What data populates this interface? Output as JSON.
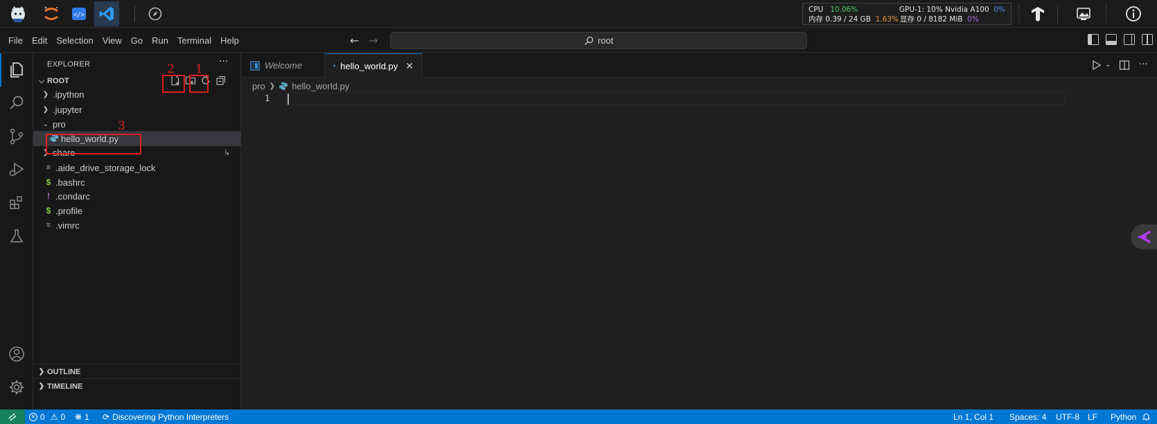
{
  "topbar": {
    "apps": [
      {
        "name": "jupyter-cat-logo"
      },
      {
        "name": "jupyter-logo"
      },
      {
        "name": "code-viewer-app"
      },
      {
        "name": "vscode-app"
      },
      {
        "name": "compass-icon"
      }
    ],
    "stats": {
      "cpu_label": "CPU",
      "cpu_value": "10.06%",
      "mem_label": "内存 0.39 / 24 GB",
      "mem_value": "1.63%",
      "gpu_label": "GPU-1: 10% Nvidia A100",
      "gpu_value": "0%",
      "vram_label": "显存 0 / 8182 MiB",
      "vram_value": "0%"
    }
  },
  "menubar": {
    "items": [
      "File",
      "Edit",
      "Selection",
      "View",
      "Go",
      "Run",
      "Terminal",
      "Help"
    ],
    "search_text": "root"
  },
  "sidebar": {
    "title": "EXPLORER",
    "root_label": "ROOT",
    "tree": [
      {
        "label": ".ipython",
        "type": "folder",
        "expanded": false
      },
      {
        "label": ".jupyter",
        "type": "folder",
        "expanded": false
      },
      {
        "label": "pro",
        "type": "folder",
        "expanded": true
      },
      {
        "label": "hello_world.py",
        "type": "python"
      },
      {
        "label": "share",
        "type": "folder",
        "expanded": false
      },
      {
        "label": ".aide_drive_storage_lock",
        "type": "text"
      },
      {
        "label": ".bashrc",
        "type": "shell"
      },
      {
        "label": ".condarc",
        "type": "config"
      },
      {
        "label": ".profile",
        "type": "shell"
      },
      {
        "label": ".vimrc",
        "type": "text"
      }
    ],
    "outline_label": "OUTLINE",
    "timeline_label": "TIMELINE"
  },
  "annotations": [
    "1",
    "2",
    "3"
  ],
  "editor": {
    "tabs": [
      {
        "label": "Welcome",
        "active": false
      },
      {
        "label": "hello_world.py",
        "active": true
      }
    ],
    "breadcrumb": [
      "pro",
      "hello_world.py"
    ],
    "line_number": "1"
  },
  "statusbar": {
    "errors": "0",
    "warnings": "0",
    "ports": "1",
    "status_message": "Discovering Python Interpreters",
    "position": "Ln 1, Col 1",
    "spaces": "Spaces: 4",
    "encoding": "UTF-8",
    "eol": "LF",
    "language": "Python"
  },
  "colors": {
    "accent": "#0078d4",
    "remote": "#16825d",
    "annotation": "#e02020"
  }
}
